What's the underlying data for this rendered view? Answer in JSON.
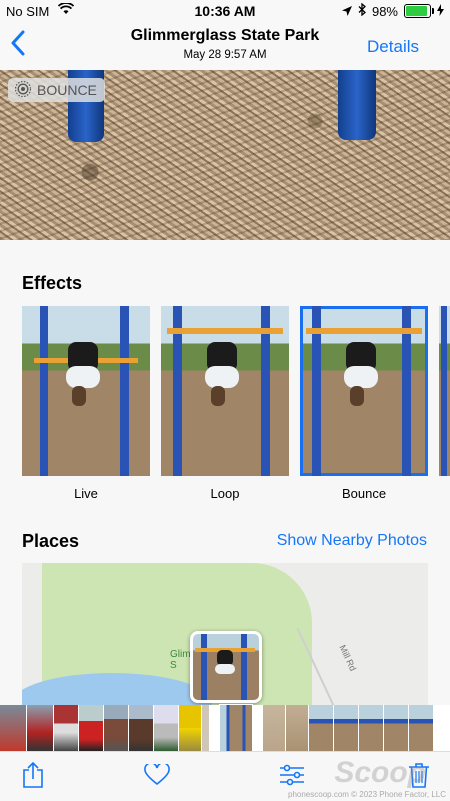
{
  "status": {
    "carrier": "No SIM",
    "time": "10:36 AM",
    "battery": "98%",
    "battery_level": 0.98
  },
  "nav": {
    "title": "Glimmerglass State Park",
    "subtitle": "May 28  9:57 AM",
    "details": "Details"
  },
  "badge": {
    "label": "BOUNCE",
    "icon": "live-photo-icon"
  },
  "effects": {
    "title": "Effects",
    "items": [
      {
        "label": "Live",
        "selected": false
      },
      {
        "label": "Loop",
        "selected": false
      },
      {
        "label": "Bounce",
        "selected": true
      }
    ]
  },
  "places": {
    "title": "Places",
    "show_nearby": "Show Nearby Photos",
    "map_place_label": "Glim\nS",
    "map_road_label": "Mill Rd"
  },
  "toolbar": {
    "icons": [
      "share-icon",
      "heart-icon",
      "adjust-icon",
      "trash-icon"
    ]
  },
  "watermark": {
    "small": "phonescoop.com  © 2023 Phone Factor, LLC",
    "big": "Scoop"
  },
  "colors": {
    "accent": "#1477f8",
    "selected_outline": "#1a6ff0"
  }
}
